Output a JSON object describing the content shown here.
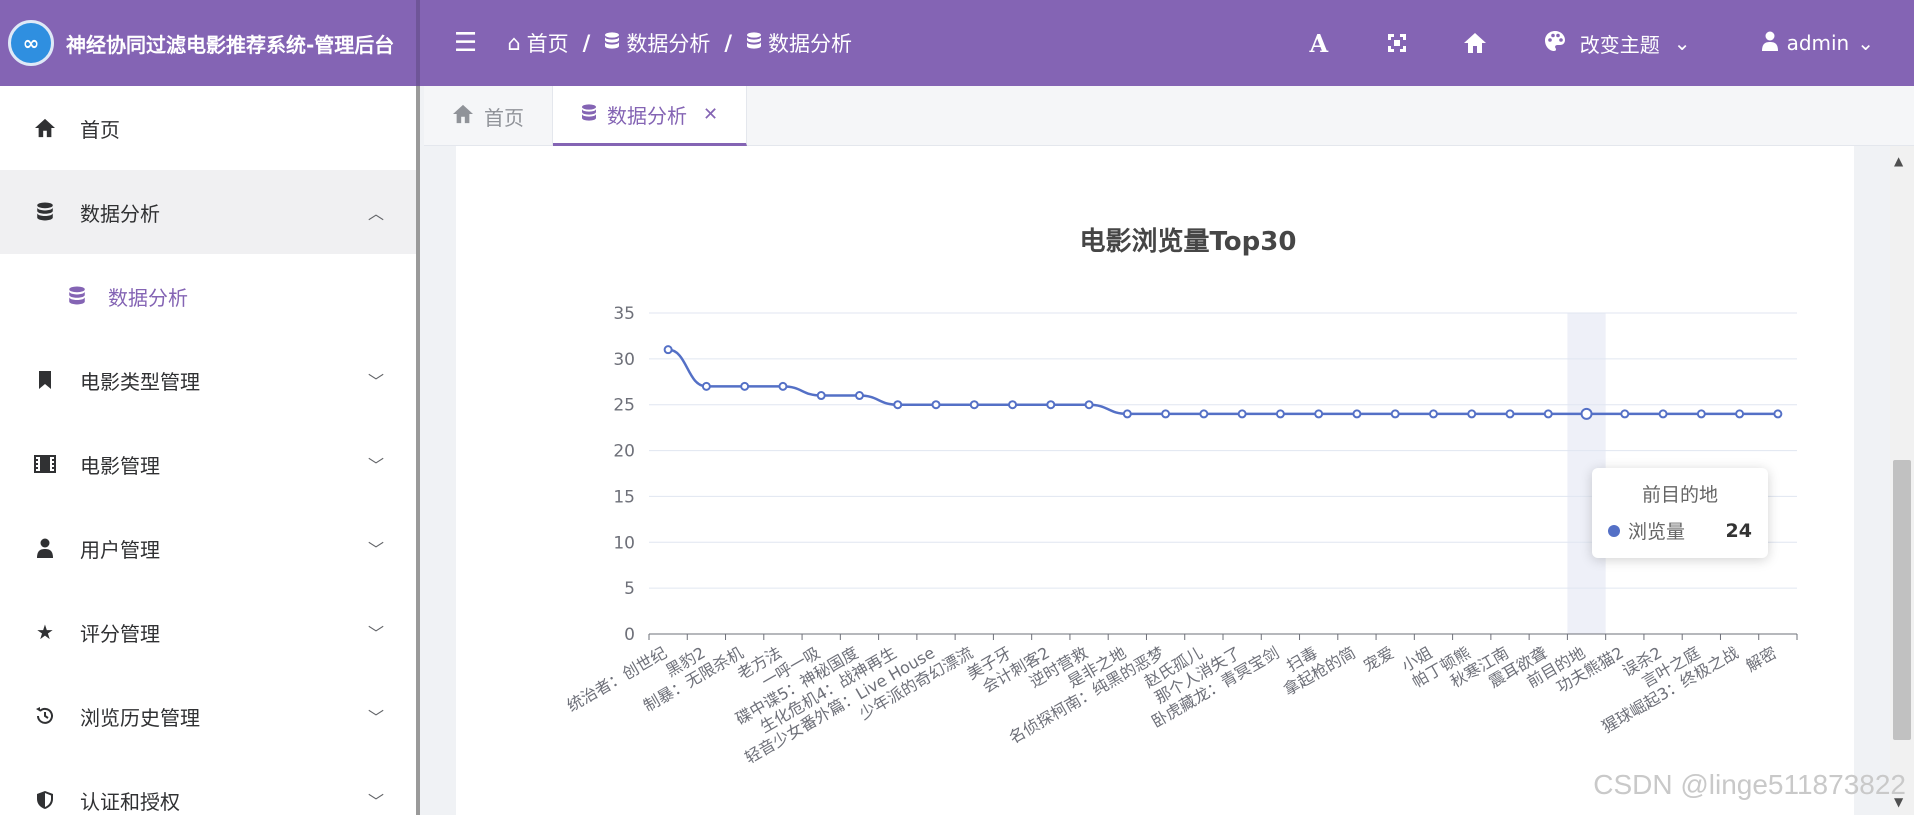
{
  "header": {
    "logo_text": "∞",
    "app_title": "神经协同过滤电影推荐系统-管理后台",
    "breadcrumb": [
      {
        "label": "首页",
        "icon": "home-icon"
      },
      {
        "label": "数据分析",
        "icon": "database-icon"
      },
      {
        "label": "数据分析",
        "icon": "database-icon"
      }
    ],
    "breadcrumb_separator": "/",
    "theme_label": "改变主题",
    "user_label": "admin"
  },
  "sidebar": {
    "items": [
      {
        "label": "首页",
        "icon": "home-icon"
      },
      {
        "label": "数据分析",
        "icon": "database-icon",
        "open": true,
        "children": [
          {
            "label": "数据分析",
            "icon": "database-icon"
          }
        ]
      },
      {
        "label": "电影类型管理",
        "icon": "bookmark-icon"
      },
      {
        "label": "电影管理",
        "icon": "film-icon"
      },
      {
        "label": "用户管理",
        "icon": "user-icon"
      },
      {
        "label": "评分管理",
        "icon": "star-icon"
      },
      {
        "label": "浏览历史管理",
        "icon": "history-icon"
      },
      {
        "label": "认证和授权",
        "icon": "shield-icon"
      }
    ]
  },
  "tabs": [
    {
      "label": "首页",
      "icon": "home-icon",
      "active": false
    },
    {
      "label": "数据分析",
      "icon": "database-icon",
      "active": true,
      "closable": true
    }
  ],
  "colors": {
    "accent": "#8464b4",
    "series": "#5470c6"
  },
  "chart_data": {
    "type": "line",
    "title": "电影浏览量Top30",
    "smooth": true,
    "ylim": [
      0,
      35
    ],
    "yticks": [
      0,
      5,
      10,
      15,
      20,
      25,
      30,
      35
    ],
    "x_label_rotation_deg": 30,
    "categories": [
      "统治者：创世纪",
      "黑豹2",
      "制暴：无限杀机",
      "老方法",
      "一呼一吸",
      "碟中谍5：神秘国度",
      "生化危机4：战神再生",
      "轻音少女番外篇：Live House",
      "少年派的奇幻漂流",
      "美子牙",
      "会计刺客2",
      "逆时营救",
      "是非之地",
      "名侦探柯南：纯黑的恶梦",
      "赵氏孤儿",
      "那个人消失了",
      "卧虎藏龙：青冥宝剑",
      "扫毒",
      "拿起枪的简",
      "宠爱",
      "小姐",
      "帕丁顿熊",
      "秋寒江南",
      "震耳欲聋",
      "前目的地",
      "功夫熊猫2",
      "误杀2",
      "言叶之庭",
      "猩球崛起3：终极之战",
      "解密"
    ],
    "series": [
      {
        "name": "浏览量",
        "values": [
          31,
          27,
          27,
          27,
          26,
          26,
          25,
          25,
          25,
          25,
          25,
          25,
          24,
          24,
          24,
          24,
          24,
          24,
          24,
          24,
          24,
          24,
          24,
          24,
          24,
          24,
          24,
          24,
          24,
          24
        ]
      }
    ],
    "highlight_index": 24,
    "tooltip": {
      "title": "前目的地",
      "series_name": "浏览量",
      "value": 24
    }
  },
  "watermark": "CSDN @linge511873822"
}
